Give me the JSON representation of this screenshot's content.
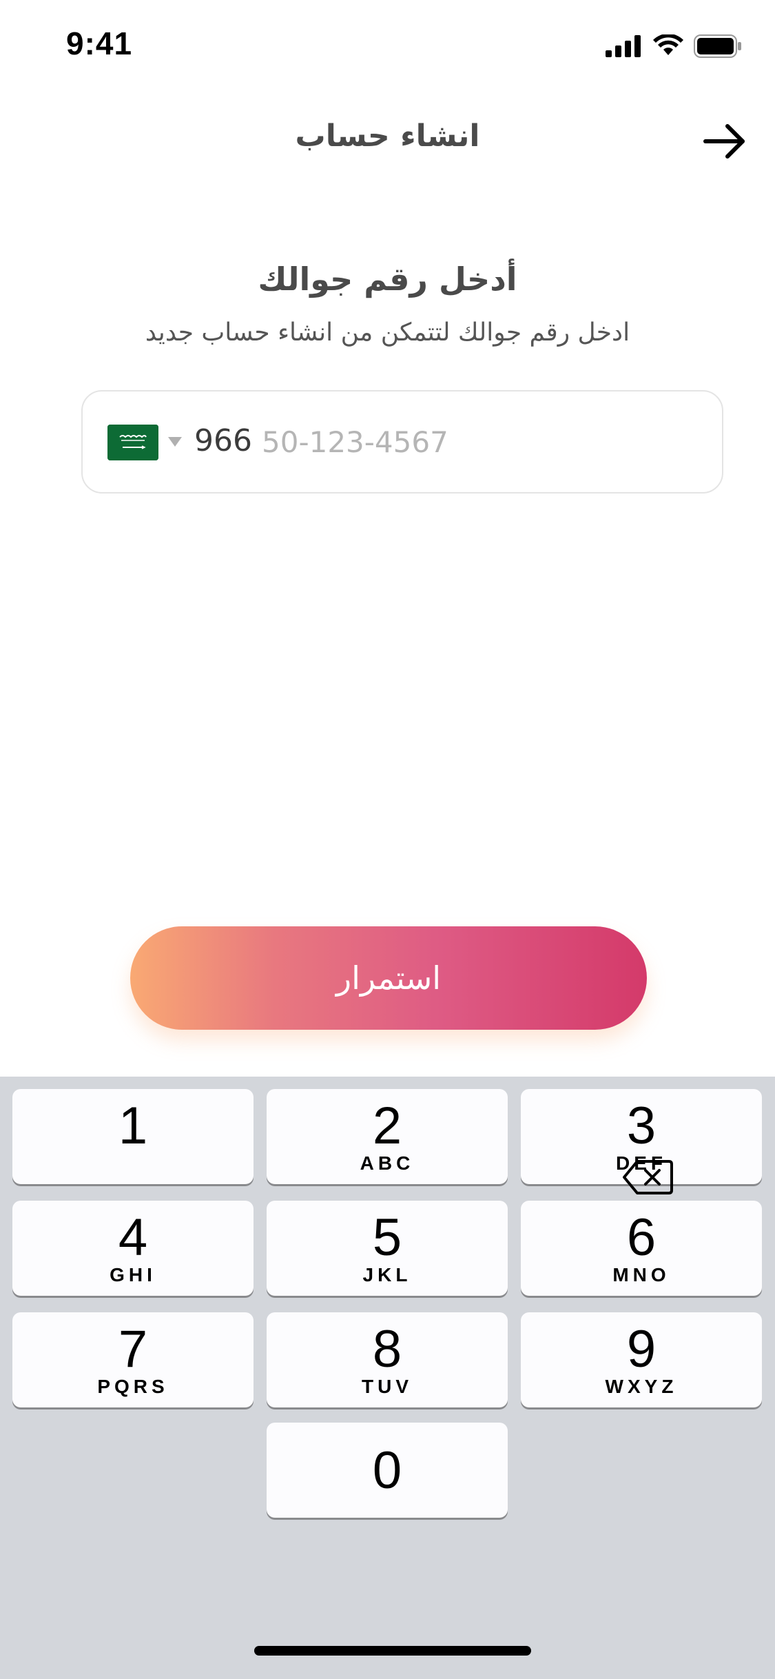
{
  "status_bar": {
    "time": "9:41"
  },
  "header": {
    "title": "انشاء حساب",
    "back_icon": "arrow-right-icon"
  },
  "intro": {
    "heading": "أدخل رقم جوالك",
    "subheading": "ادخل رقم جوالك لتتمكن من انشاء حساب جديد"
  },
  "phone": {
    "country_flag": "saudi-arabia-flag",
    "dial_code": "966",
    "value": "",
    "placeholder": "50-123-4567"
  },
  "continue_button": {
    "label": "استمرار"
  },
  "keyboard": {
    "keys": [
      {
        "digit": "1",
        "letters": ""
      },
      {
        "digit": "2",
        "letters": "ABC"
      },
      {
        "digit": "3",
        "letters": "DEF"
      },
      {
        "digit": "4",
        "letters": "GHI"
      },
      {
        "digit": "5",
        "letters": "JKL"
      },
      {
        "digit": "6",
        "letters": "MNO"
      },
      {
        "digit": "7",
        "letters": "PQRS"
      },
      {
        "digit": "8",
        "letters": "TUV"
      },
      {
        "digit": "9",
        "letters": "WXYZ"
      },
      {
        "digit": "0",
        "letters": ""
      }
    ],
    "delete_icon": "backspace-icon"
  },
  "colors": {
    "accent_start": "#f9a973",
    "accent_end": "#d43a6a",
    "keyboard_bg": "#d3d6db",
    "flag_green": "#0d6b35"
  }
}
